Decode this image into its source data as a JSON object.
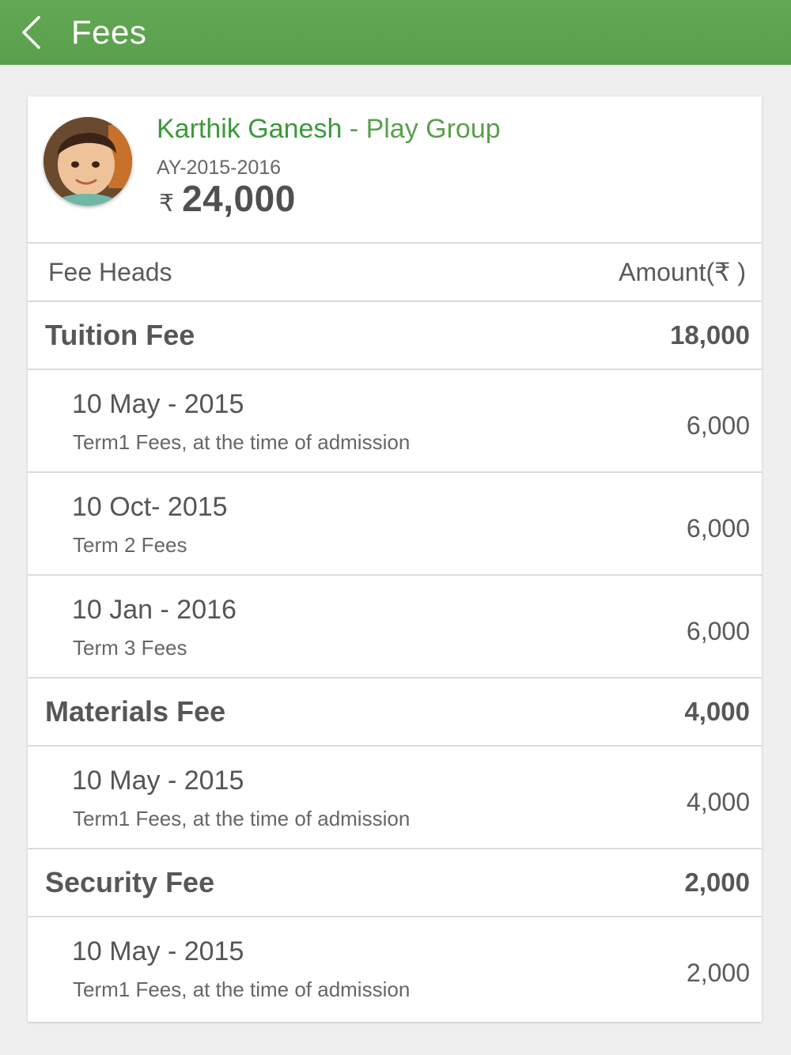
{
  "header": {
    "title": "Fees",
    "bg_color": "#5fa451",
    "back_icon": "chevron-left-icon"
  },
  "student": {
    "name": "Karthik Ganesh",
    "separator": " - ",
    "class": "Play Group",
    "academic_year": "AY-2015-2016",
    "currency_symbol": "₹",
    "total_amount": "24,000",
    "name_color": "#3a9a3a"
  },
  "table": {
    "col_head": "Fee Heads",
    "col_amount": "Amount(₹ )",
    "groups": [
      {
        "label": "Tuition Fee",
        "amount": "18,000",
        "items": [
          {
            "date": "10 May - 2015",
            "desc": "Term1 Fees, at the time of admission",
            "amount": "6,000"
          },
          {
            "date": "10 Oct- 2015",
            "desc": "Term 2 Fees",
            "amount": "6,000"
          },
          {
            "date": "10 Jan - 2016",
            "desc": "Term 3 Fees",
            "amount": "6,000"
          }
        ]
      },
      {
        "label": "Materials Fee",
        "amount": "4,000",
        "items": [
          {
            "date": "10 May - 2015",
            "desc": "Term1 Fees, at the time of admission",
            "amount": "4,000"
          }
        ]
      },
      {
        "label": "Security Fee",
        "amount": "2,000",
        "items": [
          {
            "date": "10 May - 2015",
            "desc": "Term1 Fees, at the time of admission",
            "amount": "2,000"
          }
        ]
      }
    ]
  }
}
